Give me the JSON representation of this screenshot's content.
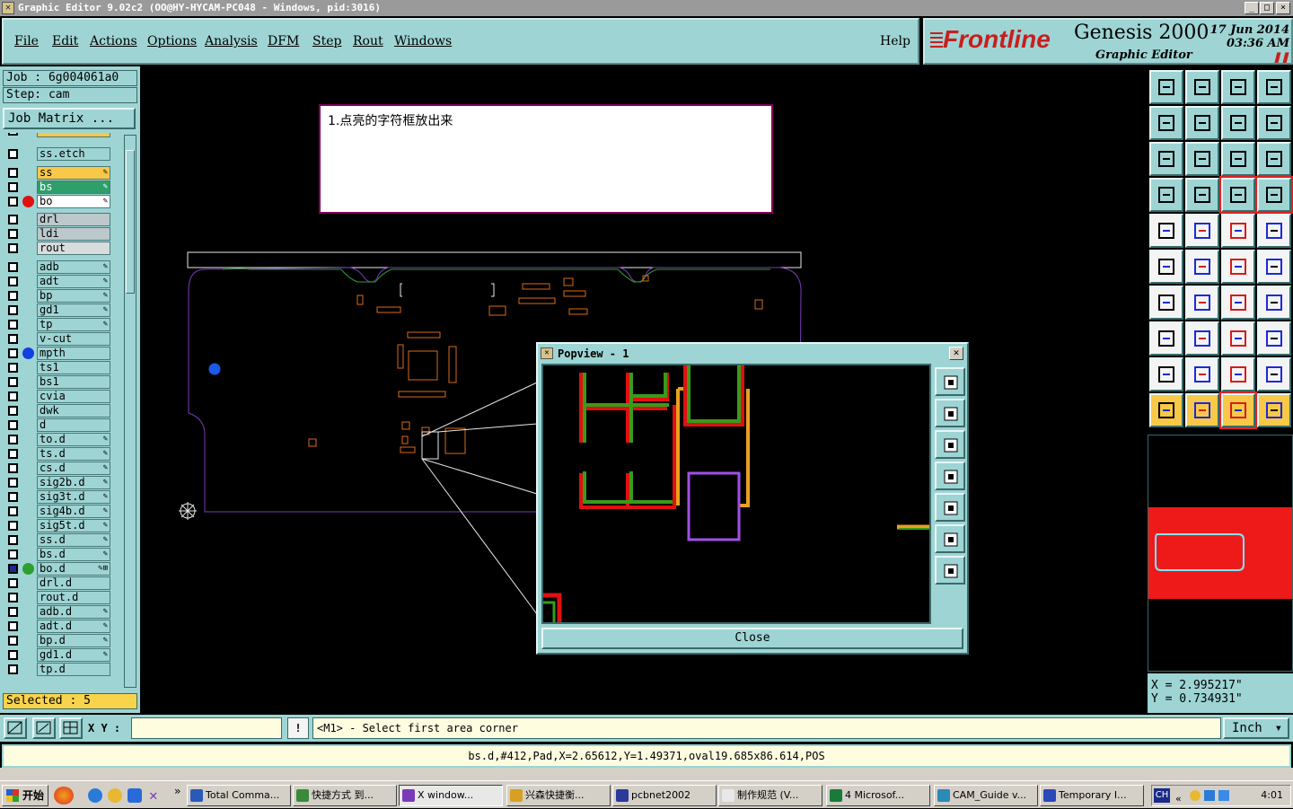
{
  "window": {
    "title": "Graphic Editor 9.02c2 (OO@HY-HYCAM-PC048 - Windows, pid:3016)",
    "min_label": "_",
    "max_label": "□",
    "close_label": "×"
  },
  "menu": [
    {
      "label": "File"
    },
    {
      "label": "Edit"
    },
    {
      "label": "Actions"
    },
    {
      "label": "Options"
    },
    {
      "label": "Analysis"
    },
    {
      "label": "DFM"
    },
    {
      "label": "Step"
    },
    {
      "label": "Rout"
    },
    {
      "label": "Windows"
    },
    {
      "label": "Help"
    }
  ],
  "brand": {
    "logo": "Frontline",
    "product": "Genesis 2000",
    "subtitle": "Graphic Editor",
    "date": "17 Jun 2014",
    "time": "03:36 AM"
  },
  "job": {
    "job_line": "Job : 6g004061a0",
    "step_line": "Step: cam",
    "matrix_label": "Job Matrix ..."
  },
  "layers": [
    {
      "name": "ss.etch",
      "color": "#9ed4d4",
      "dot": ""
    },
    {
      "name": "ss",
      "color": "#f8c848",
      "dot": "",
      "flag": "✎"
    },
    {
      "name": "bs",
      "color": "#2e9e6a",
      "dot": "",
      "flag": "✎"
    },
    {
      "name": "bo",
      "color": "#ffffff",
      "dot": "#e01010",
      "flag": "✎"
    },
    {
      "name": "drl",
      "color": "#bcc8cc",
      "dot": ""
    },
    {
      "name": "ldi",
      "color": "#bcc8cc",
      "dot": ""
    },
    {
      "name": "rout",
      "color": "#d8dcdc",
      "dot": ""
    },
    {
      "name": "adb",
      "color": "#9ed4d4",
      "dot": "",
      "flag": "✎"
    },
    {
      "name": "adt",
      "color": "#9ed4d4",
      "dot": "",
      "flag": "✎"
    },
    {
      "name": "bp",
      "color": "#9ed4d4",
      "dot": "",
      "flag": "✎"
    },
    {
      "name": "gd1",
      "color": "#9ed4d4",
      "dot": "",
      "flag": "✎"
    },
    {
      "name": "tp",
      "color": "#9ed4d4",
      "dot": "",
      "flag": "✎"
    },
    {
      "name": "v-cut",
      "color": "#9ed4d4",
      "dot": ""
    },
    {
      "name": "mpth",
      "color": "#9ed4d4",
      "dot": "#1040e0"
    },
    {
      "name": "ts1",
      "color": "#9ed4d4",
      "dot": ""
    },
    {
      "name": "bs1",
      "color": "#9ed4d4",
      "dot": ""
    },
    {
      "name": "cvia",
      "color": "#9ed4d4",
      "dot": ""
    },
    {
      "name": "dwk",
      "color": "#9ed4d4",
      "dot": ""
    },
    {
      "name": "d",
      "color": "#9ed4d4",
      "dot": ""
    },
    {
      "name": "to.d",
      "color": "#9ed4d4",
      "dot": "",
      "flag": "✎"
    },
    {
      "name": "ts.d",
      "color": "#9ed4d4",
      "dot": "",
      "flag": "✎"
    },
    {
      "name": "cs.d",
      "color": "#9ed4d4",
      "dot": "",
      "flag": "✎"
    },
    {
      "name": "sig2b.d",
      "color": "#9ed4d4",
      "dot": "",
      "flag": "✎"
    },
    {
      "name": "sig3t.d",
      "color": "#9ed4d4",
      "dot": "",
      "flag": "✎"
    },
    {
      "name": "sig4b.d",
      "color": "#9ed4d4",
      "dot": "",
      "flag": "✎"
    },
    {
      "name": "sig5t.d",
      "color": "#9ed4d4",
      "dot": "",
      "flag": "✎"
    },
    {
      "name": "ss.d",
      "color": "#9ed4d4",
      "dot": "",
      "flag": "✎"
    },
    {
      "name": "bs.d",
      "color": "#9ed4d4",
      "dot": "",
      "flag": "✎"
    },
    {
      "name": "bo.d",
      "color": "#9ed4d4",
      "dot": "#2e9e2e",
      "flag": "✎⊞"
    },
    {
      "name": "drl.d",
      "color": "#9ed4d4",
      "dot": ""
    },
    {
      "name": "rout.d",
      "color": "#9ed4d4",
      "dot": ""
    },
    {
      "name": "adb.d",
      "color": "#9ed4d4",
      "dot": "",
      "flag": "✎"
    },
    {
      "name": "adt.d",
      "color": "#9ed4d4",
      "dot": "",
      "flag": "✎"
    },
    {
      "name": "bp.d",
      "color": "#9ed4d4",
      "dot": "",
      "flag": "✎"
    },
    {
      "name": "gd1.d",
      "color": "#9ed4d4",
      "dot": "",
      "flag": "✎"
    },
    {
      "name": "tp.d",
      "color": "#9ed4d4",
      "dot": ""
    }
  ],
  "selected": "Selected : 5",
  "note": {
    "text": "1.点亮的字符框放出来"
  },
  "popview": {
    "title": "Popview - 1",
    "close_label": "Close"
  },
  "coords": {
    "x": "X = 2.995217\"",
    "y": "Y = 0.734931\""
  },
  "command": {
    "xy_label": "X Y :",
    "xy_value": "",
    "excl": "!",
    "prompt": "<M1> - Select first area corner",
    "units": "Inch"
  },
  "status": "bs.d,#412,Pad,X=2.65612,Y=1.49371,oval19.685x86.614,POS",
  "taskbar": {
    "start": "开始",
    "tasks": [
      {
        "label": "Total Comma...",
        "icon": "#2a5ab8"
      },
      {
        "label": "快捷方式 到...",
        "icon": "#3a8a3a"
      },
      {
        "label": "X window...",
        "icon": "#7a3ab8",
        "active": true
      },
      {
        "label": "兴森快捷衡...",
        "icon": "#d8a020"
      },
      {
        "label": "pcbnet2002",
        "icon": "#2a3a98"
      },
      {
        "label": "制作规范 (V...",
        "icon": "#e8e8e8"
      },
      {
        "label": "4 Microsof...",
        "icon": "#1a7a3a"
      },
      {
        "label": "CAM_Guide v...",
        "icon": "#2a8ab8"
      },
      {
        "label": "Temporary I...",
        "icon": "#2a4ab8"
      }
    ],
    "tray_lang": "CH",
    "clock": "4:01"
  }
}
